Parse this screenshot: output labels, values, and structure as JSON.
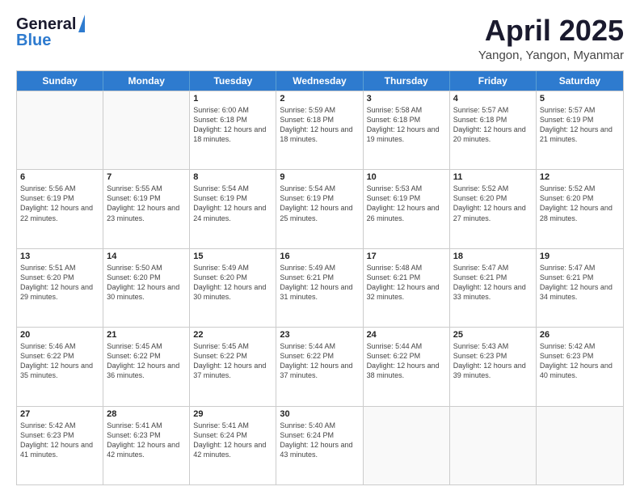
{
  "logo": {
    "line1": "General",
    "line2": "Blue"
  },
  "header": {
    "title": "April 2025",
    "subtitle": "Yangon, Yangon, Myanmar"
  },
  "days_of_week": [
    "Sunday",
    "Monday",
    "Tuesday",
    "Wednesday",
    "Thursday",
    "Friday",
    "Saturday"
  ],
  "weeks": [
    [
      {
        "day": "",
        "info": ""
      },
      {
        "day": "",
        "info": ""
      },
      {
        "day": "1",
        "info": "Sunrise: 6:00 AM\nSunset: 6:18 PM\nDaylight: 12 hours and 18 minutes."
      },
      {
        "day": "2",
        "info": "Sunrise: 5:59 AM\nSunset: 6:18 PM\nDaylight: 12 hours and 18 minutes."
      },
      {
        "day": "3",
        "info": "Sunrise: 5:58 AM\nSunset: 6:18 PM\nDaylight: 12 hours and 19 minutes."
      },
      {
        "day": "4",
        "info": "Sunrise: 5:57 AM\nSunset: 6:18 PM\nDaylight: 12 hours and 20 minutes."
      },
      {
        "day": "5",
        "info": "Sunrise: 5:57 AM\nSunset: 6:19 PM\nDaylight: 12 hours and 21 minutes."
      }
    ],
    [
      {
        "day": "6",
        "info": "Sunrise: 5:56 AM\nSunset: 6:19 PM\nDaylight: 12 hours and 22 minutes."
      },
      {
        "day": "7",
        "info": "Sunrise: 5:55 AM\nSunset: 6:19 PM\nDaylight: 12 hours and 23 minutes."
      },
      {
        "day": "8",
        "info": "Sunrise: 5:54 AM\nSunset: 6:19 PM\nDaylight: 12 hours and 24 minutes."
      },
      {
        "day": "9",
        "info": "Sunrise: 5:54 AM\nSunset: 6:19 PM\nDaylight: 12 hours and 25 minutes."
      },
      {
        "day": "10",
        "info": "Sunrise: 5:53 AM\nSunset: 6:19 PM\nDaylight: 12 hours and 26 minutes."
      },
      {
        "day": "11",
        "info": "Sunrise: 5:52 AM\nSunset: 6:20 PM\nDaylight: 12 hours and 27 minutes."
      },
      {
        "day": "12",
        "info": "Sunrise: 5:52 AM\nSunset: 6:20 PM\nDaylight: 12 hours and 28 minutes."
      }
    ],
    [
      {
        "day": "13",
        "info": "Sunrise: 5:51 AM\nSunset: 6:20 PM\nDaylight: 12 hours and 29 minutes."
      },
      {
        "day": "14",
        "info": "Sunrise: 5:50 AM\nSunset: 6:20 PM\nDaylight: 12 hours and 30 minutes."
      },
      {
        "day": "15",
        "info": "Sunrise: 5:49 AM\nSunset: 6:20 PM\nDaylight: 12 hours and 30 minutes."
      },
      {
        "day": "16",
        "info": "Sunrise: 5:49 AM\nSunset: 6:21 PM\nDaylight: 12 hours and 31 minutes."
      },
      {
        "day": "17",
        "info": "Sunrise: 5:48 AM\nSunset: 6:21 PM\nDaylight: 12 hours and 32 minutes."
      },
      {
        "day": "18",
        "info": "Sunrise: 5:47 AM\nSunset: 6:21 PM\nDaylight: 12 hours and 33 minutes."
      },
      {
        "day": "19",
        "info": "Sunrise: 5:47 AM\nSunset: 6:21 PM\nDaylight: 12 hours and 34 minutes."
      }
    ],
    [
      {
        "day": "20",
        "info": "Sunrise: 5:46 AM\nSunset: 6:22 PM\nDaylight: 12 hours and 35 minutes."
      },
      {
        "day": "21",
        "info": "Sunrise: 5:45 AM\nSunset: 6:22 PM\nDaylight: 12 hours and 36 minutes."
      },
      {
        "day": "22",
        "info": "Sunrise: 5:45 AM\nSunset: 6:22 PM\nDaylight: 12 hours and 37 minutes."
      },
      {
        "day": "23",
        "info": "Sunrise: 5:44 AM\nSunset: 6:22 PM\nDaylight: 12 hours and 37 minutes."
      },
      {
        "day": "24",
        "info": "Sunrise: 5:44 AM\nSunset: 6:22 PM\nDaylight: 12 hours and 38 minutes."
      },
      {
        "day": "25",
        "info": "Sunrise: 5:43 AM\nSunset: 6:23 PM\nDaylight: 12 hours and 39 minutes."
      },
      {
        "day": "26",
        "info": "Sunrise: 5:42 AM\nSunset: 6:23 PM\nDaylight: 12 hours and 40 minutes."
      }
    ],
    [
      {
        "day": "27",
        "info": "Sunrise: 5:42 AM\nSunset: 6:23 PM\nDaylight: 12 hours and 41 minutes."
      },
      {
        "day": "28",
        "info": "Sunrise: 5:41 AM\nSunset: 6:23 PM\nDaylight: 12 hours and 42 minutes."
      },
      {
        "day": "29",
        "info": "Sunrise: 5:41 AM\nSunset: 6:24 PM\nDaylight: 12 hours and 42 minutes."
      },
      {
        "day": "30",
        "info": "Sunrise: 5:40 AM\nSunset: 6:24 PM\nDaylight: 12 hours and 43 minutes."
      },
      {
        "day": "",
        "info": ""
      },
      {
        "day": "",
        "info": ""
      },
      {
        "day": "",
        "info": ""
      }
    ]
  ]
}
